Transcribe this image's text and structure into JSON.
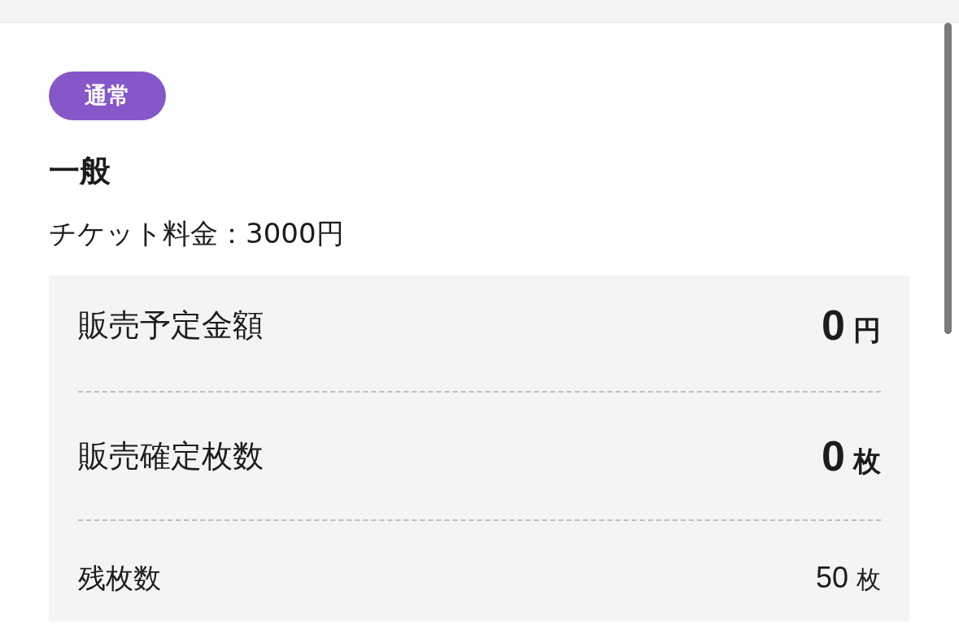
{
  "badge": {
    "label": "通常"
  },
  "ticket": {
    "title": "一般",
    "price": "チケット料金：3000円"
  },
  "summary": {
    "rows": [
      {
        "kind": "major",
        "label": "販売予定金額",
        "value": "0",
        "unit": "円"
      },
      {
        "kind": "major",
        "label": "販売確定枚数",
        "value": "0",
        "unit": "枚"
      },
      {
        "kind": "minor",
        "label": "残枚数",
        "value": "50",
        "unit": "枚"
      }
    ]
  }
}
